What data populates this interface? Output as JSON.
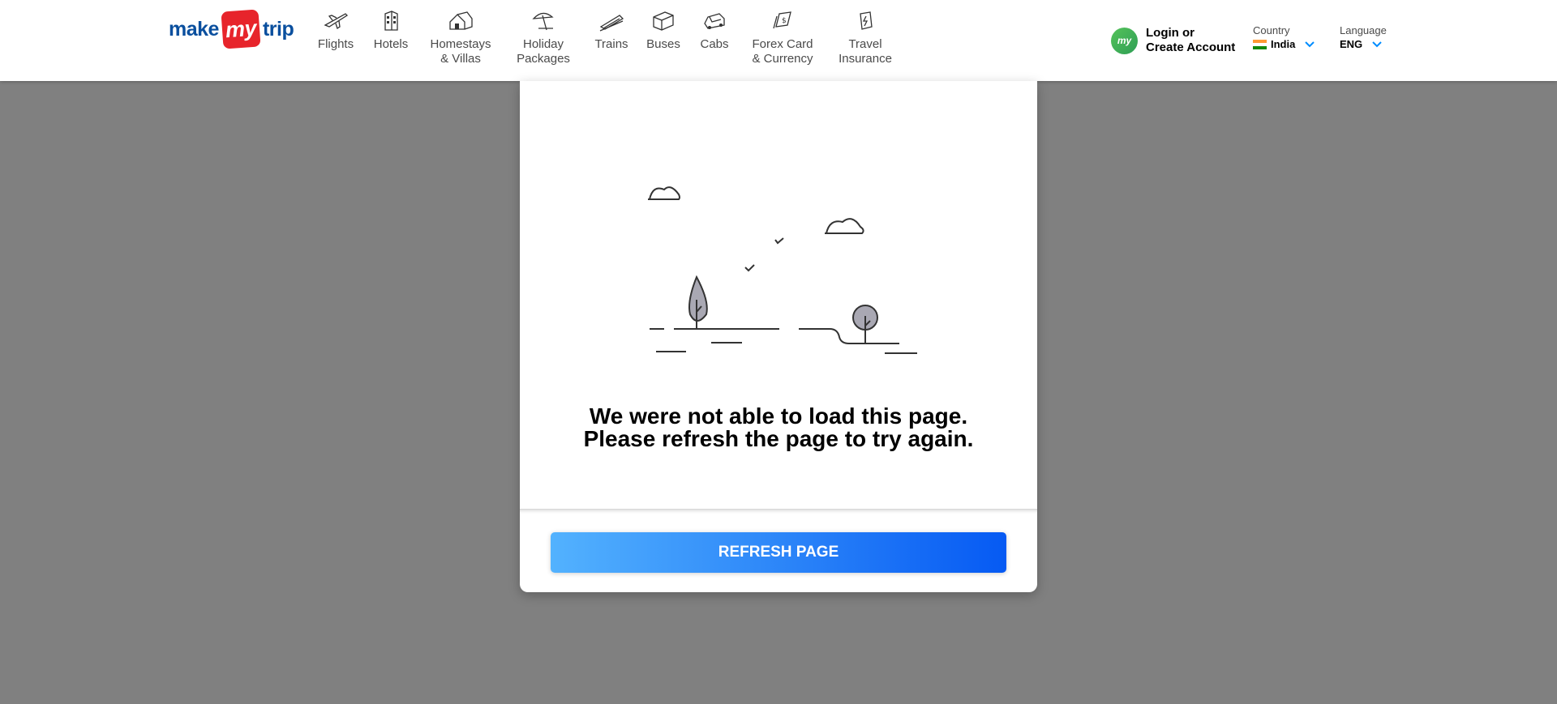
{
  "header": {
    "logo": {
      "make": "make",
      "my": "my",
      "trip": "trip"
    },
    "nav": [
      {
        "label": "Flights",
        "icon": "flight-icon"
      },
      {
        "label": "Hotels",
        "icon": "hotel-icon"
      },
      {
        "label": "Homestays\n& Villas",
        "icon": "homestay-icon"
      },
      {
        "label": "Holiday\nPackages",
        "icon": "holiday-icon"
      },
      {
        "label": "Trains",
        "icon": "train-icon"
      },
      {
        "label": "Buses",
        "icon": "bus-icon"
      },
      {
        "label": "Cabs",
        "icon": "cab-icon"
      },
      {
        "label": "Forex Card\n& Currency",
        "icon": "forex-icon"
      },
      {
        "label": "Travel\nInsurance",
        "icon": "insurance-icon"
      }
    ],
    "login": {
      "avatar": "my",
      "text": "Login or\nCreate Account"
    },
    "country": {
      "label": "Country",
      "value": "India"
    },
    "language": {
      "label": "Language",
      "value": "ENG"
    }
  },
  "error": {
    "line1": "We were not able to load this page.",
    "line2": "Please refresh the page to try again."
  },
  "refresh_button": "REFRESH PAGE",
  "colors": {
    "overlay": "#808080",
    "brand_blue": "#0a4f9e",
    "brand_red": "#e7242b",
    "button_start": "#53b2fe",
    "button_end": "#065af3"
  }
}
